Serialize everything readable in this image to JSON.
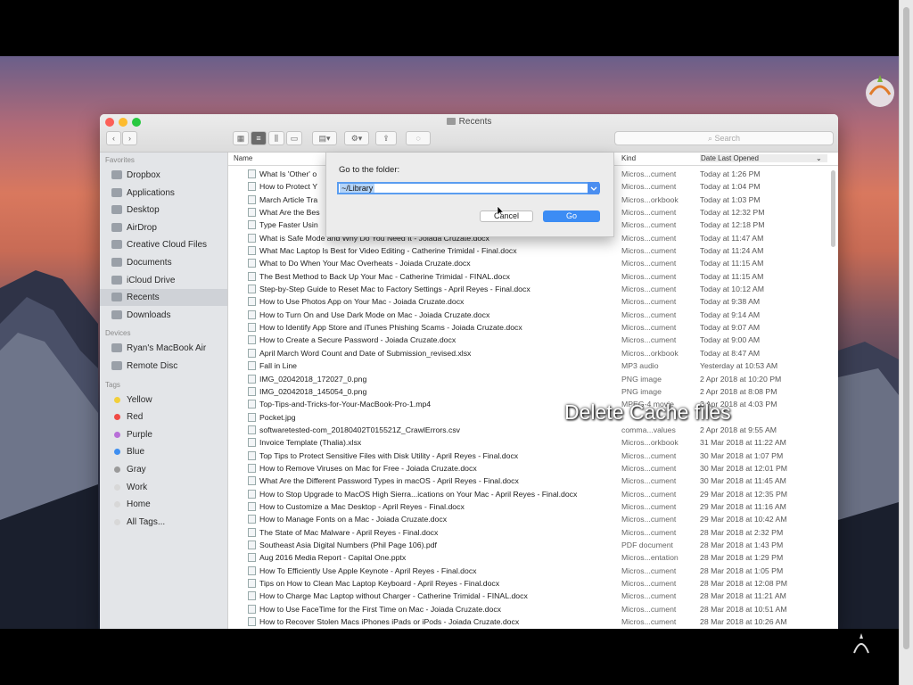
{
  "window": {
    "title": "Recents"
  },
  "toolbar": {
    "search_placeholder": "Search"
  },
  "sidebar": {
    "favorites_label": "Favorites",
    "favorites": [
      {
        "label": "Dropbox",
        "icon": "dropbox-icon"
      },
      {
        "label": "Applications",
        "icon": "applications-icon"
      },
      {
        "label": "Desktop",
        "icon": "desktop-icon"
      },
      {
        "label": "AirDrop",
        "icon": "airdrop-icon"
      },
      {
        "label": "Creative Cloud Files",
        "icon": "creative-cloud-icon"
      },
      {
        "label": "Documents",
        "icon": "documents-icon"
      },
      {
        "label": "iCloud Drive",
        "icon": "icloud-icon"
      },
      {
        "label": "Recents",
        "icon": "recents-icon",
        "active": true
      },
      {
        "label": "Downloads",
        "icon": "downloads-icon"
      }
    ],
    "devices_label": "Devices",
    "devices": [
      {
        "label": "Ryan's MacBook Air",
        "icon": "laptop-icon"
      },
      {
        "label": "Remote Disc",
        "icon": "disc-icon"
      }
    ],
    "tags_label": "Tags",
    "tags": [
      {
        "label": "Yellow",
        "color": "#f2cf3a"
      },
      {
        "label": "Red",
        "color": "#f04a45"
      },
      {
        "label": "Purple",
        "color": "#b86fd8"
      },
      {
        "label": "Blue",
        "color": "#3e8ef0"
      },
      {
        "label": "Gray",
        "color": "#9a9a9a"
      },
      {
        "label": "Work",
        "color": "#d8d8d8"
      },
      {
        "label": "Home",
        "color": "#d8d8d8"
      },
      {
        "label": "All Tags...",
        "color": "#d8d8d8"
      }
    ]
  },
  "columns": {
    "name": "Name",
    "kind": "Kind",
    "date": "Date Last Opened"
  },
  "files": [
    {
      "name": "What Is 'Other' o",
      "kind": "Micros...cument",
      "date": "Today at 1:26 PM"
    },
    {
      "name": "How to Protect Y",
      "kind": "Micros...cument",
      "date": "Today at 1:04 PM"
    },
    {
      "name": "March Article Tra",
      "kind": "Micros...orkbook",
      "date": "Today at 1:03 PM"
    },
    {
      "name": "What Are the Bes",
      "kind": "Micros...cument",
      "date": "Today at 12:32 PM"
    },
    {
      "name": "Type Faster Usin",
      "kind": "Micros...cument",
      "date": "Today at 12:18 PM"
    },
    {
      "name": "What is Safe Mode and Why Do You Need It - Joiada Cruzate.docx",
      "kind": "Micros...cument",
      "date": "Today at 11:47 AM"
    },
    {
      "name": "What Mac Laptop Is Best for Video Editing - Catherine Trimidal - Final.docx",
      "kind": "Micros...cument",
      "date": "Today at 11:24 AM"
    },
    {
      "name": "What to Do When Your Mac Overheats - Joiada Cruzate.docx",
      "kind": "Micros...cument",
      "date": "Today at 11:15 AM"
    },
    {
      "name": "The Best Method to Back Up Your Mac - Catherine Trimidal - FINAL.docx",
      "kind": "Micros...cument",
      "date": "Today at 11:15 AM"
    },
    {
      "name": "Step-by-Step Guide to Reset Mac to Factory Settings - April Reyes - Final.docx",
      "kind": "Micros...cument",
      "date": "Today at 10:12 AM"
    },
    {
      "name": "How to Use Photos App on Your Mac - Joiada Cruzate.docx",
      "kind": "Micros...cument",
      "date": "Today at 9:38 AM"
    },
    {
      "name": "How to Turn On and Use Dark Mode on Mac - Joiada Cruzate.docx",
      "kind": "Micros...cument",
      "date": "Today at 9:14 AM"
    },
    {
      "name": "How to Identify App Store and iTunes Phishing Scams - Joiada Cruzate.docx",
      "kind": "Micros...cument",
      "date": "Today at 9:07 AM"
    },
    {
      "name": "How to Create a Secure Password - Joiada Cruzate.docx",
      "kind": "Micros...cument",
      "date": "Today at 9:00 AM"
    },
    {
      "name": "April March Word Count and Date of Submission_revised.xlsx",
      "kind": "Micros...orkbook",
      "date": "Today at 8:47 AM"
    },
    {
      "name": "Fall in Line",
      "kind": "MP3 audio",
      "date": "Yesterday at 10:53 AM"
    },
    {
      "name": "IMG_02042018_172027_0.png",
      "kind": "PNG image",
      "date": "2 Apr 2018 at 10:20 PM"
    },
    {
      "name": "IMG_02042018_145054_0.png",
      "kind": "PNG image",
      "date": "2 Apr 2018 at 8:08 PM"
    },
    {
      "name": "Top-Tips-and-Tricks-for-Your-MacBook-Pro-1.mp4",
      "kind": "MPEG-4 movie",
      "date": "2 Apr 2018 at 4:03 PM"
    },
    {
      "name": "Pocket.jpg",
      "kind": "",
      "date": ""
    },
    {
      "name": "softwaretested-com_20180402T015521Z_CrawlErrors.csv",
      "kind": "comma...values",
      "date": "2 Apr 2018 at 9:55 AM"
    },
    {
      "name": "Invoice Template (Thalia).xlsx",
      "kind": "Micros...orkbook",
      "date": "31 Mar 2018 at 11:22 AM"
    },
    {
      "name": "Top Tips to Protect Sensitive Files with Disk Utility - April Reyes - Final.docx",
      "kind": "Micros...cument",
      "date": "30 Mar 2018 at 1:07 PM"
    },
    {
      "name": "How to Remove Viruses on Mac for Free - Joiada Cruzate.docx",
      "kind": "Micros...cument",
      "date": "30 Mar 2018 at 12:01 PM"
    },
    {
      "name": "What Are the Different Password Types in macOS - April Reyes - Final.docx",
      "kind": "Micros...cument",
      "date": "30 Mar 2018 at 11:45 AM"
    },
    {
      "name": "How to Stop Upgrade to MacOS High Sierra...ications on Your Mac - April Reyes - Final.docx",
      "kind": "Micros...cument",
      "date": "29 Mar 2018 at 12:35 PM"
    },
    {
      "name": "How to Customize a Mac Desktop - April Reyes - Final.docx",
      "kind": "Micros...cument",
      "date": "29 Mar 2018 at 11:16 AM"
    },
    {
      "name": "How to Manage Fonts on a Mac - Joiada Cruzate.docx",
      "kind": "Micros...cument",
      "date": "29 Mar 2018 at 10:42 AM"
    },
    {
      "name": "The State of Mac Malware - April Reyes - Final.docx",
      "kind": "Micros...cument",
      "date": "28 Mar 2018 at 2:32 PM"
    },
    {
      "name": "Southeast Asia Digital Numbers (Phil Page 106).pdf",
      "kind": "PDF document",
      "date": "28 Mar 2018 at 1:43 PM"
    },
    {
      "name": "Aug 2016 Media Report - Capital One.pptx",
      "kind": "Micros...entation",
      "date": "28 Mar 2018 at 1:29 PM"
    },
    {
      "name": "How To Efficiently Use Apple Keynote - April Reyes - Final.docx",
      "kind": "Micros...cument",
      "date": "28 Mar 2018 at 1:05 PM"
    },
    {
      "name": "Tips on How to Clean Mac Laptop Keyboard - April Reyes - Final.docx",
      "kind": "Micros...cument",
      "date": "28 Mar 2018 at 12:08 PM"
    },
    {
      "name": "How to Charge Mac Laptop without Charger - Catherine Trimidal - FINAL.docx",
      "kind": "Micros...cument",
      "date": "28 Mar 2018 at 11:21 AM"
    },
    {
      "name": "How to Use FaceTime for the First Time on Mac - Joiada Cruzate.docx",
      "kind": "Micros...cument",
      "date": "28 Mar 2018 at 10:51 AM"
    },
    {
      "name": "How to Recover Stolen Macs iPhones iPads or iPods - Joiada Cruzate.docx",
      "kind": "Micros...cument",
      "date": "28 Mar 2018 at 10:26 AM"
    }
  ],
  "dialog": {
    "label": "Go to the folder:",
    "path_value": "~/Library",
    "cancel_label": "Cancel",
    "go_label": "Go"
  },
  "caption": "Delete Cache files"
}
